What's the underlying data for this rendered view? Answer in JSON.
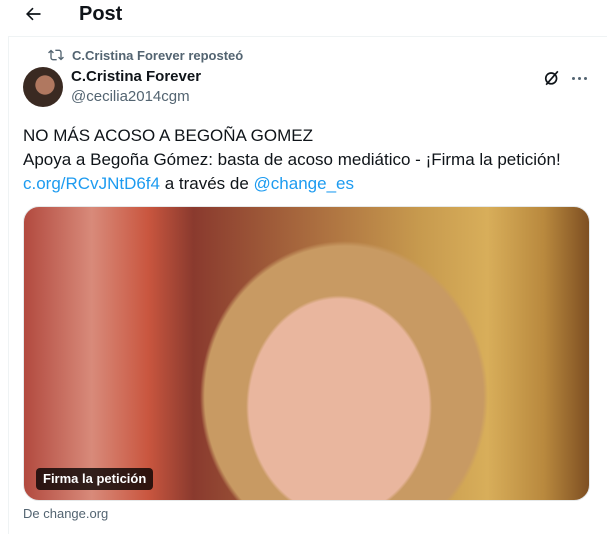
{
  "header": {
    "title": "Post"
  },
  "repost": {
    "text": "C.Cristina Forever reposteó"
  },
  "author": {
    "name": "C.Cristina Forever",
    "handle": "@cecilia2014cgm"
  },
  "post": {
    "line1": "NO MÁS ACOSO A BEGOÑA GOMEZ",
    "line2": "Apoya a Begoña Gómez: basta de acoso mediático - ¡Firma la petición!",
    "link": "c.org/RCvJNtD6f4",
    "via": " a través de ",
    "mention": "@change_es"
  },
  "media": {
    "label": "Firma la petición"
  },
  "source": {
    "text": "De change.org"
  },
  "colors": {
    "link": "#1d9bf0",
    "secondary": "#536471",
    "text": "#0f1419"
  }
}
